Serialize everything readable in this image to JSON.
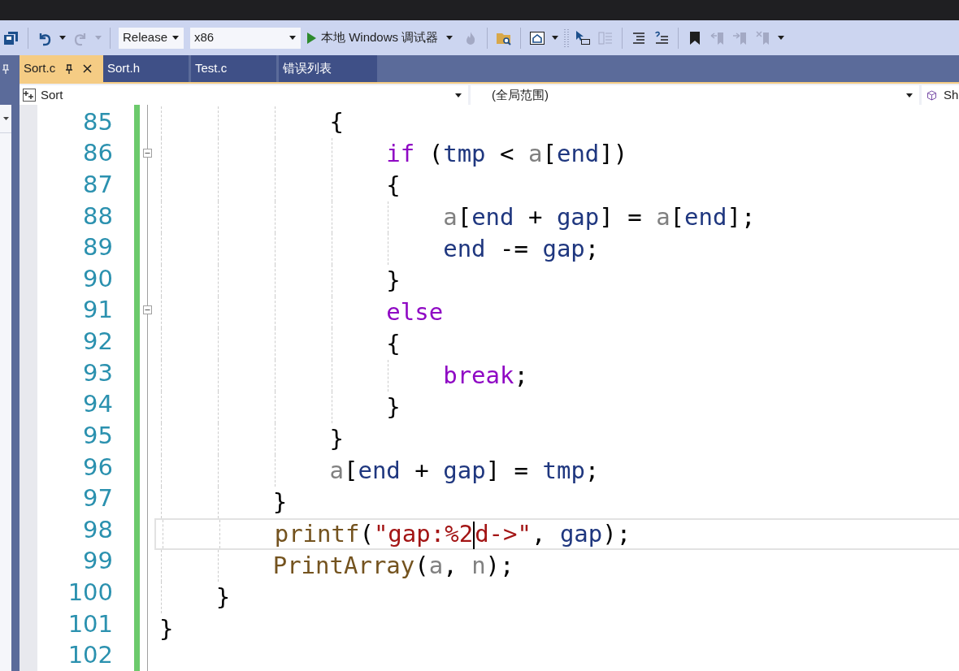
{
  "toolbar": {
    "items": [
      {
        "kind": "save",
        "disabled": false
      },
      {
        "kind": "separator"
      },
      {
        "kind": "undo",
        "disabled": false
      },
      {
        "kind": "caret",
        "disabled": false
      },
      {
        "kind": "redo",
        "disabled": true
      },
      {
        "kind": "caret",
        "disabled": true
      },
      {
        "kind": "separator"
      },
      {
        "kind": "config-dropdown",
        "value": "Release"
      },
      {
        "kind": "platform-dropdown",
        "value": "x86"
      },
      {
        "kind": "run",
        "label": "本地 Windows 调试器"
      },
      {
        "kind": "flame",
        "disabled": true
      },
      {
        "kind": "separator"
      },
      {
        "kind": "folder-search",
        "disabled": false
      },
      {
        "kind": "separator"
      },
      {
        "kind": "home",
        "disabled": false
      },
      {
        "kind": "caret",
        "disabled": false
      },
      {
        "kind": "grip"
      },
      {
        "kind": "cursor",
        "disabled": false
      },
      {
        "kind": "columns",
        "disabled": true
      },
      {
        "kind": "separator"
      },
      {
        "kind": "indent",
        "disabled": false
      },
      {
        "kind": "comment",
        "disabled": false
      },
      {
        "kind": "separator"
      },
      {
        "kind": "bookmark",
        "disabled": false
      },
      {
        "kind": "bookmark-prev",
        "disabled": true
      },
      {
        "kind": "bookmark-next",
        "disabled": true
      },
      {
        "kind": "bookmark-clear",
        "disabled": true
      },
      {
        "kind": "caret",
        "disabled": false
      }
    ]
  },
  "tabs": [
    {
      "label": "Sort.c",
      "selected": true,
      "pinned": true
    },
    {
      "label": "Sort.h",
      "selected": false,
      "pinned": false
    },
    {
      "label": "Test.c",
      "selected": false,
      "pinned": false
    },
    {
      "label": "错误列表",
      "selected": false,
      "pinned": false
    }
  ],
  "nav_bar": {
    "project": "Sort",
    "scope": "(全局范围)",
    "member": "Sh"
  },
  "editor": {
    "lines": [
      {
        "number": "85",
        "fold_marker": false,
        "current": false,
        "tokens": [
          {
            "kind": "plain",
            "text": "            {"
          }
        ]
      },
      {
        "number": "86",
        "fold_marker": true,
        "current": false,
        "tokens": [
          {
            "kind": "keyword",
            "text": "                if"
          },
          {
            "kind": "plain",
            "text": " ("
          },
          {
            "kind": "local",
            "text": "tmp"
          },
          {
            "kind": "plain",
            "text": " < "
          },
          {
            "kind": "param",
            "text": "a"
          },
          {
            "kind": "plain",
            "text": "["
          },
          {
            "kind": "local",
            "text": "end"
          },
          {
            "kind": "plain",
            "text": "])"
          }
        ]
      },
      {
        "number": "87",
        "fold_marker": false,
        "current": false,
        "tokens": [
          {
            "kind": "plain",
            "text": "                {"
          }
        ]
      },
      {
        "number": "88",
        "fold_marker": false,
        "current": false,
        "tokens": [
          {
            "kind": "param",
            "text": "                    a"
          },
          {
            "kind": "plain",
            "text": "["
          },
          {
            "kind": "local",
            "text": "end"
          },
          {
            "kind": "plain",
            "text": " + "
          },
          {
            "kind": "local",
            "text": "gap"
          },
          {
            "kind": "plain",
            "text": "] = "
          },
          {
            "kind": "param",
            "text": "a"
          },
          {
            "kind": "plain",
            "text": "["
          },
          {
            "kind": "local",
            "text": "end"
          },
          {
            "kind": "plain",
            "text": "];"
          }
        ]
      },
      {
        "number": "89",
        "fold_marker": false,
        "current": false,
        "tokens": [
          {
            "kind": "local",
            "text": "                    end"
          },
          {
            "kind": "plain",
            "text": " -= "
          },
          {
            "kind": "local",
            "text": "gap"
          },
          {
            "kind": "plain",
            "text": ";"
          }
        ]
      },
      {
        "number": "90",
        "fold_marker": false,
        "current": false,
        "tokens": [
          {
            "kind": "plain",
            "text": "                }"
          }
        ]
      },
      {
        "number": "91",
        "fold_marker": true,
        "current": false,
        "tokens": [
          {
            "kind": "keyword",
            "text": "                else"
          }
        ]
      },
      {
        "number": "92",
        "fold_marker": false,
        "current": false,
        "tokens": [
          {
            "kind": "plain",
            "text": "                {"
          }
        ]
      },
      {
        "number": "93",
        "fold_marker": false,
        "current": false,
        "tokens": [
          {
            "kind": "keyword",
            "text": "                    break"
          },
          {
            "kind": "plain",
            "text": ";"
          }
        ]
      },
      {
        "number": "94",
        "fold_marker": false,
        "current": false,
        "tokens": [
          {
            "kind": "plain",
            "text": "                }"
          }
        ]
      },
      {
        "number": "95",
        "fold_marker": false,
        "current": false,
        "tokens": [
          {
            "kind": "plain",
            "text": "            }"
          }
        ]
      },
      {
        "number": "96",
        "fold_marker": false,
        "current": false,
        "tokens": [
          {
            "kind": "param",
            "text": "            a"
          },
          {
            "kind": "plain",
            "text": "["
          },
          {
            "kind": "local",
            "text": "end"
          },
          {
            "kind": "plain",
            "text": " + "
          },
          {
            "kind": "local",
            "text": "gap"
          },
          {
            "kind": "plain",
            "text": "] = "
          },
          {
            "kind": "local",
            "text": "tmp"
          },
          {
            "kind": "plain",
            "text": ";"
          }
        ]
      },
      {
        "number": "97",
        "fold_marker": false,
        "current": false,
        "tokens": [
          {
            "kind": "plain",
            "text": "        }"
          }
        ]
      },
      {
        "number": "98",
        "fold_marker": false,
        "current": true,
        "tokens": [
          {
            "kind": "function",
            "text": "        printf"
          },
          {
            "kind": "plain",
            "text": "("
          },
          {
            "kind": "string",
            "text": "\"gap:%2",
            "caret_after": true
          },
          {
            "kind": "string",
            "text": "d->\""
          },
          {
            "kind": "plain",
            "text": ", "
          },
          {
            "kind": "local",
            "text": "gap"
          },
          {
            "kind": "plain",
            "text": ");"
          }
        ]
      },
      {
        "number": "99",
        "fold_marker": false,
        "current": false,
        "tokens": [
          {
            "kind": "function",
            "text": "        PrintArray"
          },
          {
            "kind": "plain",
            "text": "("
          },
          {
            "kind": "param",
            "text": "a"
          },
          {
            "kind": "plain",
            "text": ", "
          },
          {
            "kind": "param",
            "text": "n"
          },
          {
            "kind": "plain",
            "text": ");"
          }
        ]
      },
      {
        "number": "100",
        "fold_marker": false,
        "current": false,
        "tokens": [
          {
            "kind": "plain",
            "text": "    }"
          }
        ]
      },
      {
        "number": "101",
        "fold_marker": false,
        "current": false,
        "tokens": [
          {
            "kind": "plain",
            "text": "}"
          }
        ]
      },
      {
        "number": "102",
        "fold_marker": false,
        "current": false
      }
    ]
  }
}
